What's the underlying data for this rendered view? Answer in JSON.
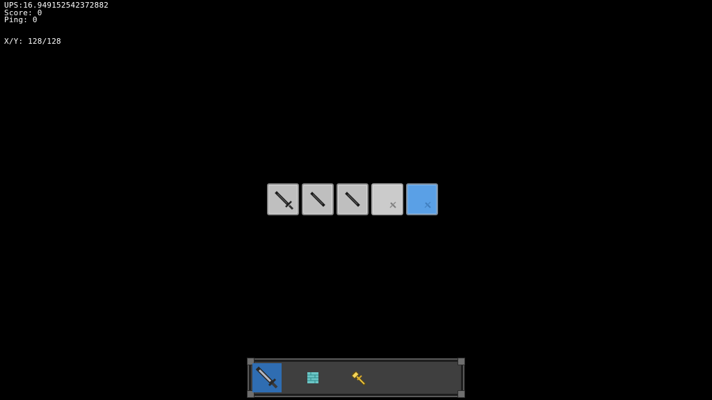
{
  "debug": {
    "ups": "UPS:16.949152542372882",
    "score": "Score: 0",
    "ping": "Ping: 0",
    "xy": "X/Y: 128/128"
  },
  "slots": [
    {
      "name": "slot-1",
      "icon": "sword-icon",
      "state": "normal"
    },
    {
      "name": "slot-2",
      "icon": "blade-icon",
      "state": "normal"
    },
    {
      "name": "slot-3",
      "icon": "blade-icon",
      "state": "normal"
    },
    {
      "name": "slot-4",
      "icon": "small-sword-icon",
      "state": "faded"
    },
    {
      "name": "slot-5",
      "icon": "small-sword-icon",
      "state": "active"
    }
  ],
  "hotbar": {
    "items": [
      {
        "name": "hotbar-item-sword",
        "icon": "sword-icon",
        "selected": true
      },
      {
        "name": "hotbar-item-brick",
        "icon": "brick-block-icon",
        "selected": false
      },
      {
        "name": "hotbar-item-wand",
        "icon": "golden-wand-icon",
        "selected": false
      }
    ]
  },
  "colors": {
    "background": "#000000",
    "slot": "#bfbfbf",
    "slot_active": "#5aa0e6",
    "hotbar": "#3f3f3f",
    "hotbar_selected": "#2f6db2"
  }
}
